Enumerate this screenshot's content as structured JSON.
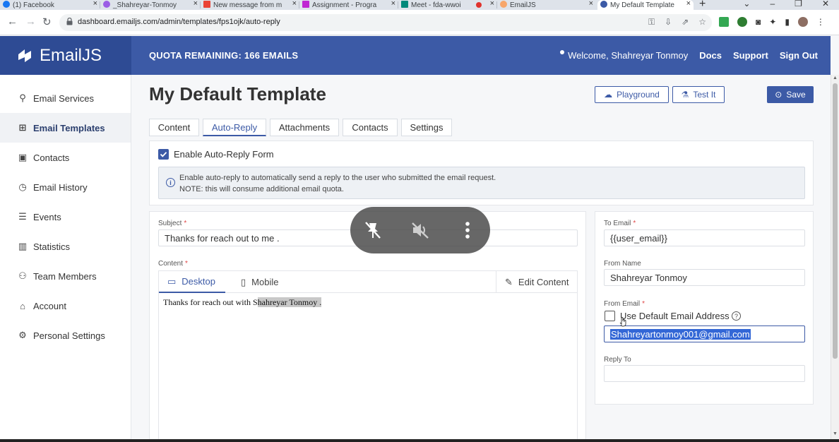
{
  "browser": {
    "tabs": [
      {
        "label": "(1) Facebook",
        "fav": "#1877f2"
      },
      {
        "label": "_Shahreyar-Tonmoy",
        "fav": "#9b5de5"
      },
      {
        "label": "New message from m",
        "fav": "#ea4335"
      },
      {
        "label": "Assignment - Progra",
        "fav": "#c026d3"
      },
      {
        "label": "Meet - fda-wwoi",
        "fav": "#00897b"
      },
      {
        "label": "EmailJS",
        "fav": "#f7a66a"
      },
      {
        "label": "My Default Template",
        "fav": "#3c5aa6"
      }
    ],
    "url": "dashboard.emailjs.com/admin/templates/fps1ojk/auto-reply"
  },
  "header": {
    "logo": "EmailJS",
    "quota": "QUOTA REMAINING: 166 EMAILS",
    "welcome": "Welcome,",
    "user": "Shahreyar Tonmoy",
    "links": [
      "Docs",
      "Support",
      "Sign Out"
    ]
  },
  "sidebar": {
    "items": [
      {
        "label": "Email Services",
        "icon": "plug-icon"
      },
      {
        "label": "Email Templates",
        "icon": "templates-icon"
      },
      {
        "label": "Contacts",
        "icon": "contacts-icon"
      },
      {
        "label": "Email History",
        "icon": "history-icon"
      },
      {
        "label": "Events",
        "icon": "list-icon"
      },
      {
        "label": "Statistics",
        "icon": "chart-icon"
      },
      {
        "label": "Team Members",
        "icon": "team-icon"
      },
      {
        "label": "Account",
        "icon": "bank-icon"
      },
      {
        "label": "Personal Settings",
        "icon": "gear-icon"
      }
    ]
  },
  "page": {
    "title": "My Default Template",
    "playground": "Playground",
    "test": "Test It",
    "save": "Save",
    "tabs": [
      "Content",
      "Auto-Reply",
      "Attachments",
      "Contacts",
      "Settings"
    ],
    "enable_label": "Enable Auto-Reply Form",
    "info_line1": "Enable auto-reply to automatically send a reply to the user who submitted the email request.",
    "info_line2": "NOTE: this will consume additional email quota."
  },
  "form": {
    "subject_label": "Subject",
    "subject_value": "Thanks for reach out to me .",
    "content_label": "Content",
    "desktop_tab": "Desktop",
    "mobile_tab": "Mobile",
    "edit_content": "Edit Content",
    "body_text": "Thanks for reach out with S",
    "body_highlight": "hahreyar Tonmoy .",
    "to_label": "To Email",
    "to_value": "{{user_email}}",
    "from_name_label": "From Name",
    "from_name_value": "Shahreyar Tonmoy",
    "from_email_label": "From Email",
    "default_email_label": "Use Default Email Address",
    "from_email_value": "Shahreyartonmoy001@gmail.com",
    "reply_to_label": "Reply To"
  },
  "colors": {
    "brand": "#3c5aa6",
    "brand_dark": "#2e4b94",
    "required": "#e04848"
  }
}
